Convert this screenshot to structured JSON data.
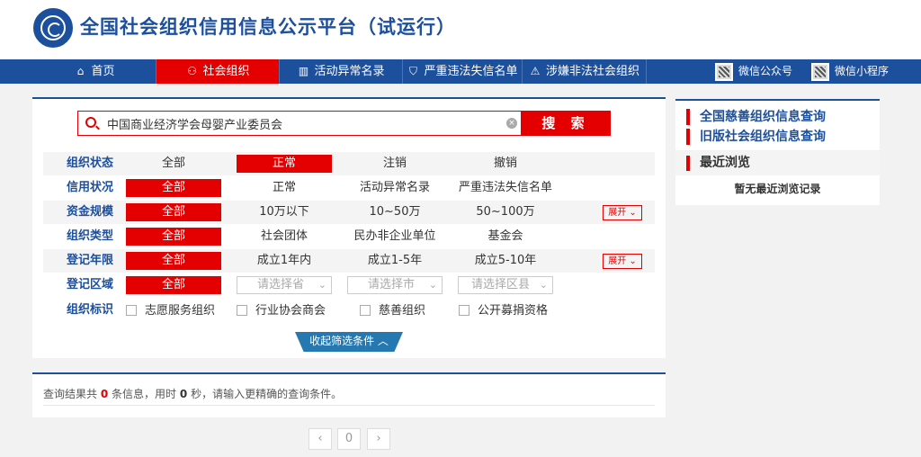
{
  "header": {
    "title": "全国社会组织信用信息公示平台（试运行）"
  },
  "nav": {
    "items": [
      {
        "label": "首页",
        "icon": "home-icon"
      },
      {
        "label": "社会组织",
        "icon": "users-icon"
      },
      {
        "label": "活动异常名录",
        "icon": "book-icon"
      },
      {
        "label": "严重违法失信名单",
        "icon": "shield-icon"
      },
      {
        "label": "涉嫌非法社会组织",
        "icon": "warning-icon"
      }
    ],
    "wechat_public": "微信公众号",
    "wechat_mini": "微信小程序"
  },
  "search": {
    "value": "中国商业经济学会母婴产业委员会",
    "button": "搜 索"
  },
  "filters": {
    "status": {
      "label": "组织状态",
      "options": [
        "全部",
        "正常",
        "注销",
        "撤销"
      ],
      "selected": "正常"
    },
    "credit": {
      "label": "信用状况",
      "options": [
        "全部",
        "正常",
        "活动异常名录",
        "严重违法失信名单"
      ],
      "selected": "全部"
    },
    "capital": {
      "label": "资金规模",
      "options": [
        "全部",
        "10万以下",
        "10~50万",
        "50~100万"
      ],
      "selected": "全部",
      "expand": "展开"
    },
    "type": {
      "label": "组织类型",
      "options": [
        "全部",
        "社会团体",
        "民办非企业单位",
        "基金会"
      ],
      "selected": "全部"
    },
    "years": {
      "label": "登记年限",
      "options": [
        "全部",
        "成立1年内",
        "成立1-5年",
        "成立5-10年"
      ],
      "selected": "全部",
      "expand": "展开"
    },
    "region": {
      "label": "登记区域",
      "all": "全部",
      "province": "请选择省",
      "city": "请选择市",
      "county": "请选择区县"
    },
    "marks": {
      "label": "组织标识",
      "options": [
        "志愿服务组织",
        "行业协会商会",
        "慈善组织",
        "公开募捐资格"
      ]
    },
    "collapse": "收起筛选条件"
  },
  "result": {
    "prefix": "查询结果共",
    "count": "0",
    "mid": "条信息，用时",
    "time": "0",
    "suffix": "秒，请输入更精确的查询条件。"
  },
  "pagination": {
    "prev": "‹",
    "page": "0",
    "next": "›"
  },
  "sidebar": {
    "links": [
      "全国慈善组织信息查询",
      "旧版社会组织信息查询"
    ],
    "recent_title": "最近浏览",
    "recent_empty": "暂无最近浏览记录"
  },
  "colors": {
    "brand_blue": "#1c4f9c",
    "accent_red": "#e40000"
  }
}
